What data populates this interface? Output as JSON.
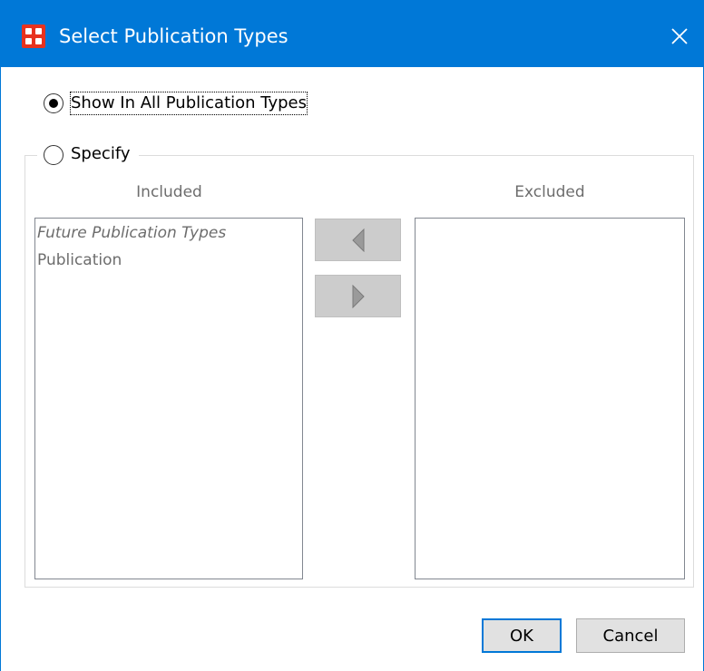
{
  "window": {
    "title": "Select Publication Types",
    "app_icon": "app-logo-icon",
    "close_icon": "close-icon",
    "accent_color": "#0078d7"
  },
  "options": {
    "show_all_label": "Show In All Publication Types",
    "show_all_selected": true,
    "specify_label": "Specify",
    "specify_selected": false
  },
  "included": {
    "header": "Included",
    "items": [
      {
        "label": "Future Publication Types",
        "italic": true
      },
      {
        "label": "Publication",
        "italic": false
      }
    ]
  },
  "excluded": {
    "header": "Excluded",
    "items": []
  },
  "transfer_buttons": {
    "move_left_icon": "triangle-left-icon",
    "move_right_icon": "triangle-right-icon",
    "enabled": false
  },
  "footer": {
    "ok_label": "OK",
    "cancel_label": "Cancel"
  }
}
